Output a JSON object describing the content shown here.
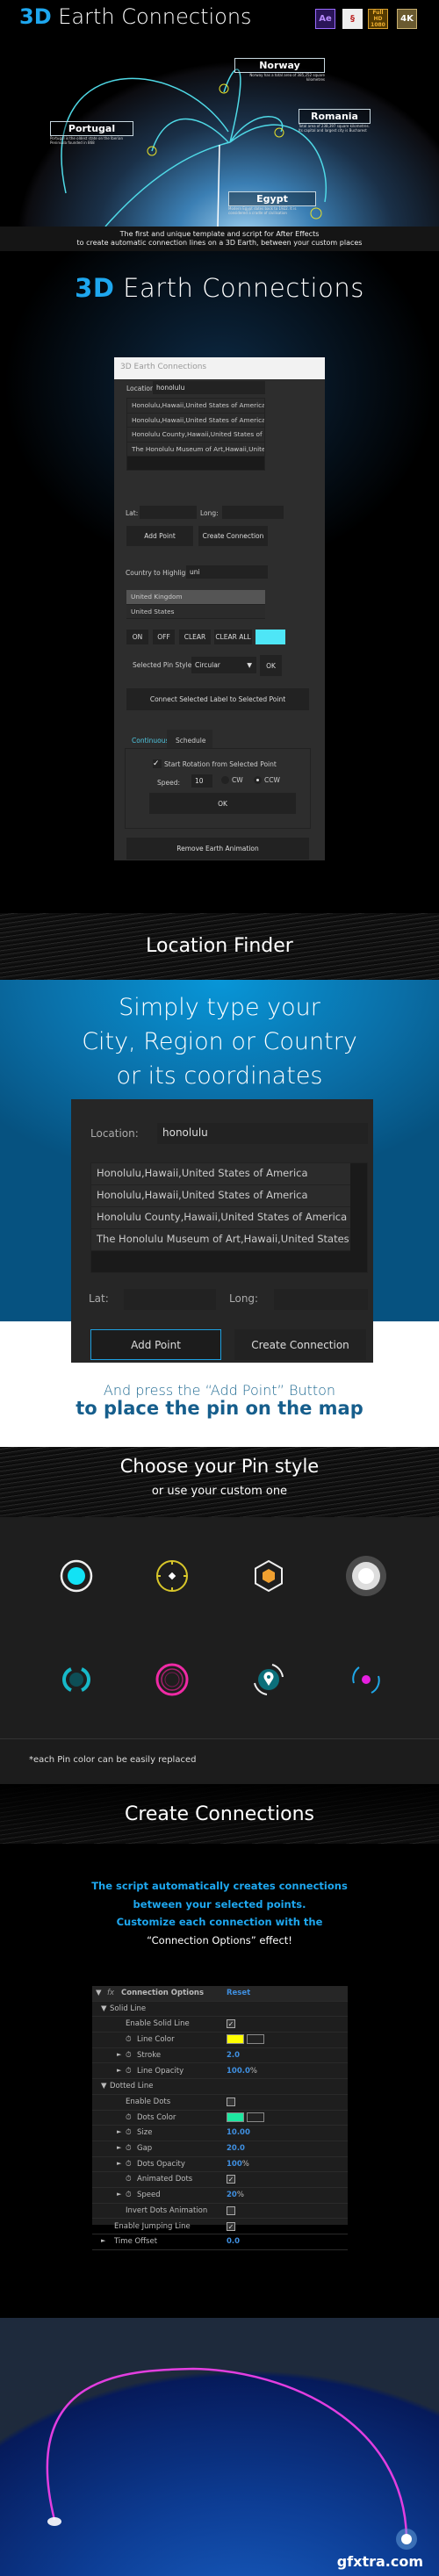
{
  "hero": {
    "title_accent": "3D",
    "title_rest": " Earth Connections",
    "badges": [
      {
        "icon": "after-effects-icon",
        "text": "Ae"
      },
      {
        "icon": "script-icon",
        "text": ""
      },
      {
        "icon": "full-hd-icon",
        "text": "Full HD 1080"
      },
      {
        "icon": "4k-icon",
        "text": "4K"
      }
    ],
    "labels": [
      {
        "name": "Norway",
        "desc": "Norway has a total area of 385,252 square kilometres"
      },
      {
        "name": "Portugal",
        "desc": "Portugal is the oldest state on the Iberian Peninsula founded in 868"
      },
      {
        "name": "Romania",
        "desc": "Total area of 238,397 square kilometres. Its capital and largest city is Bucharest"
      },
      {
        "name": "Egypt",
        "desc": "Modern Egypt dates back to 1922. It is considered a cradle of civilisation"
      }
    ],
    "caption_1": "The first and unique template and script for After Effects",
    "caption_2": "to create automatic connection lines on a 3D Earth, between your custom places",
    "accent": "#1ea7ef",
    "line_color": "#4fd9e6"
  },
  "section_title": {
    "accent": "3D",
    "rest": " Earth Connections"
  },
  "panel": {
    "window_title": "3D Earth Connections",
    "location_label": "Location:",
    "location_value": "honolulu",
    "results": [
      "Honolulu,Hawaii,United States of America",
      "Honolulu,Hawaii,United States of America",
      "Honolulu County,Hawaii,United States of America",
      "The Honolulu Museum of Art,Hawaii,United States"
    ],
    "lat_label": "Lat:",
    "long_label": "Long:",
    "add_point": "Add Point",
    "create_connection": "Create Connection",
    "country_label": "Country to Highlight:",
    "country_value": "uni",
    "countries": [
      "United Kingdom",
      "United States"
    ],
    "on": "ON",
    "off": "OFF",
    "clear": "CLEAR",
    "clear_all": "CLEAR ALL",
    "highlight_color": "#4ee6f7",
    "pin_style_label": "Selected Pin Style:",
    "pin_style_value": "Circular",
    "ok": "OK",
    "connect_label": "Connect Selected Label to Selected Point",
    "tabs": [
      "Continuous",
      "Schedule"
    ],
    "start_rotation": "Start Rotation from Selected Point",
    "start_rotation_checked": true,
    "speed_label": "Speed:",
    "speed_value": "10",
    "cw": "CW",
    "ccw": "CCW",
    "direction": "CCW",
    "rotate_ok": "OK",
    "remove": "Remove Earth Animation"
  },
  "location_finder": {
    "title": "Location Finder",
    "line1": "Simply type your",
    "line2": "City, Region or Country",
    "line3": "or its coordinates",
    "press": "And press the “Add Point” Button",
    "place": "to place the pin on the map"
  },
  "pins": {
    "title": "Choose your Pin style",
    "subtitle": "or use your custom one",
    "styles": [
      "circle-dot",
      "crosshair",
      "hexagon",
      "glow",
      "brackets",
      "rings",
      "map-marker",
      "orbit"
    ],
    "footnote": "*each Pin color can be easily replaced"
  },
  "connections": {
    "title": "Create Connections",
    "text1": "The script automatically creates connections",
    "text2": "between your selected points.",
    "text3": "Customize each connection with the",
    "text4": "“Connection Options” effect!",
    "fx": {
      "name": "Connection Options",
      "reset": "Reset",
      "rows": [
        {
          "label": "Solid Line",
          "indent": 1,
          "group": true
        },
        {
          "label": "Enable Solid Line",
          "indent": 2,
          "checkbox": true
        },
        {
          "label": "Line Color",
          "indent": 2,
          "color": "#ffff00",
          "stopwatch": true
        },
        {
          "label": "Stroke",
          "indent": 2,
          "value": "2.0",
          "stopwatch": true,
          "arrow": true
        },
        {
          "label": "Line Opacity",
          "indent": 2,
          "value": "100.0",
          "unit": "%",
          "stopwatch": true,
          "arrow": true
        },
        {
          "label": "Dotted Line",
          "indent": 1,
          "group": true
        },
        {
          "label": "Enable Dots",
          "indent": 2,
          "checkbox": false
        },
        {
          "label": "Dots Color",
          "indent": 2,
          "color": "#1ee8a0",
          "stopwatch": true
        },
        {
          "label": "Size",
          "indent": 2,
          "value": "10.00",
          "stopwatch": true,
          "arrow": true
        },
        {
          "label": "Gap",
          "indent": 2,
          "value": "20.0",
          "stopwatch": true,
          "arrow": true
        },
        {
          "label": "Dots Opacity",
          "indent": 2,
          "value": "100",
          "unit": "%",
          "stopwatch": true,
          "arrow": true
        },
        {
          "label": "Animated Dots",
          "indent": 2,
          "checkbox": true,
          "stopwatch": true
        },
        {
          "label": "Speed",
          "indent": 2,
          "value": "20",
          "unit": "%",
          "stopwatch": true,
          "arrow": true
        },
        {
          "label": "Invert Dots Animation",
          "indent": 2,
          "checkbox": false
        },
        {
          "label": "Enable Jumping Line",
          "indent": 1,
          "checkbox": true
        },
        {
          "label": "Time Offset",
          "indent": 1,
          "value": "0.0",
          "arrow": true
        }
      ]
    }
  },
  "watermark": "gfxtra.com",
  "arc_color": "#e23ee0"
}
